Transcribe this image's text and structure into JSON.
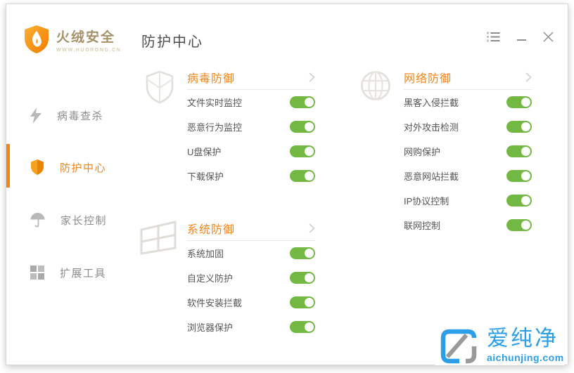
{
  "brand": {
    "name": "火绒安全",
    "site": "WWW.HUORONG.CN"
  },
  "page_title": "防护中心",
  "window_controls": {
    "menu": "menu",
    "minimize": "minimize",
    "close": "close"
  },
  "sidebar": {
    "active_index": 1,
    "items": [
      {
        "label": "病毒查杀",
        "icon": "lightning-icon"
      },
      {
        "label": "防护中心",
        "icon": "shield-icon"
      },
      {
        "label": "家长控制",
        "icon": "umbrella-icon"
      },
      {
        "label": "扩展工具",
        "icon": "grid-icon"
      }
    ]
  },
  "sections": [
    {
      "title": "病毒防御",
      "icon": "shield-outline-icon",
      "items": [
        {
          "label": "文件实时监控",
          "enabled": true
        },
        {
          "label": "恶意行为监控",
          "enabled": true
        },
        {
          "label": "U盘保护",
          "enabled": true
        },
        {
          "label": "下载保护",
          "enabled": true
        }
      ]
    },
    {
      "title": "系统防御",
      "icon": "windows-icon",
      "items": [
        {
          "label": "系统加固",
          "enabled": true
        },
        {
          "label": "自定义防护",
          "enabled": true
        },
        {
          "label": "软件安装拦截",
          "enabled": true
        },
        {
          "label": "浏览器保护",
          "enabled": true
        }
      ]
    },
    {
      "title": "网络防御",
      "icon": "globe-icon",
      "items": [
        {
          "label": "黑客入侵拦截",
          "enabled": true
        },
        {
          "label": "对外攻击检测",
          "enabled": true
        },
        {
          "label": "网购保护",
          "enabled": true
        },
        {
          "label": "恶意网站拦截",
          "enabled": true
        },
        {
          "label": "IP协议控制",
          "enabled": true
        },
        {
          "label": "联网控制",
          "enabled": true
        }
      ]
    }
  ],
  "watermark": {
    "name": "爱纯净",
    "domain": "aichunjing.com"
  },
  "colors": {
    "accent_orange": "#f0851a",
    "toggle_green": "#72b843",
    "watermark_blue": "#2c9fe8",
    "brand_text": "#a5926a"
  }
}
